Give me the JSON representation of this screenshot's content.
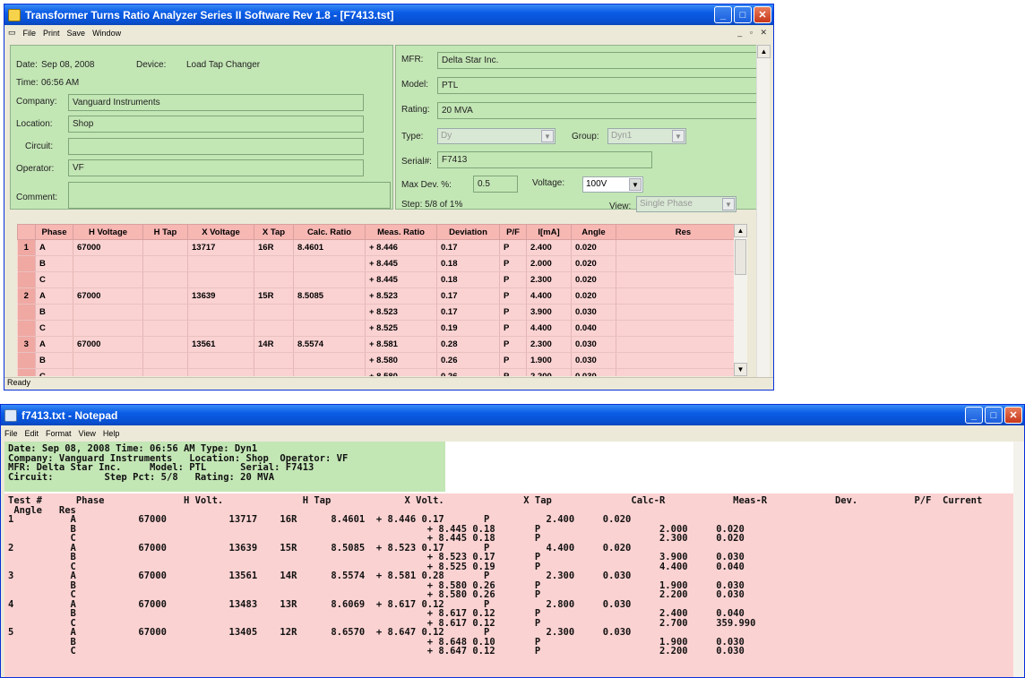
{
  "main_window": {
    "title": "Transformer Turns Ratio Analyzer Series II Software Rev 1.8 - [F7413.tst]",
    "menu": [
      "File",
      "Print",
      "Save",
      "Window"
    ],
    "status": "Ready"
  },
  "form": {
    "date_label": "Date:",
    "date": "Sep 08, 2008",
    "device_label": "Device:",
    "device": "Load Tap Changer",
    "time_label": "Time:",
    "time": "06:56 AM",
    "company_label": "Company:",
    "company": "Vanguard Instruments",
    "location_label": "Location:",
    "location": "Shop",
    "circuit_label": "Circuit:",
    "circuit": "",
    "operator_label": "Operator:",
    "operator": "VF",
    "comment_label": "Comment:",
    "comment": "",
    "mfr_label": "MFR:",
    "mfr": "Delta Star Inc.",
    "model_label": "Model:",
    "model": "PTL",
    "rating_label": "Rating:",
    "rating": "20 MVA",
    "type_label": "Type:",
    "type": "Dy",
    "group_label": "Group:",
    "group": "Dyn1",
    "serial_label": "Serial#:",
    "serial": "F7413",
    "maxdev_label": "Max Dev. %:",
    "maxdev": "0.5",
    "voltage_label": "Voltage:",
    "voltage": "100V",
    "step_label": "Step: 5/8 of 1%",
    "view_label": "View:",
    "view": "Single Phase"
  },
  "grid": {
    "headers": [
      "",
      "Phase",
      "H Voltage",
      "H Tap",
      "X Voltage",
      "X Tap",
      "Calc. Ratio",
      "Meas. Ratio",
      "Deviation",
      "P/F",
      "I[mA]",
      "Angle",
      "Res"
    ],
    "rows": [
      [
        "1",
        "A",
        "67000",
        "",
        "13717",
        "16R",
        "8.4601",
        "+ 8.446",
        "0.17",
        "P",
        "2.400",
        "0.020",
        ""
      ],
      [
        "",
        "B",
        "",
        "",
        "",
        "",
        "",
        "+ 8.445",
        "0.18",
        "P",
        "2.000",
        "0.020",
        ""
      ],
      [
        "",
        "C",
        "",
        "",
        "",
        "",
        "",
        "+ 8.445",
        "0.18",
        "P",
        "2.300",
        "0.020",
        ""
      ],
      [
        "2",
        "A",
        "67000",
        "",
        "13639",
        "15R",
        "8.5085",
        "+ 8.523",
        "0.17",
        "P",
        "4.400",
        "0.020",
        ""
      ],
      [
        "",
        "B",
        "",
        "",
        "",
        "",
        "",
        "+ 8.523",
        "0.17",
        "P",
        "3.900",
        "0.030",
        ""
      ],
      [
        "",
        "C",
        "",
        "",
        "",
        "",
        "",
        "+ 8.525",
        "0.19",
        "P",
        "4.400",
        "0.040",
        ""
      ],
      [
        "3",
        "A",
        "67000",
        "",
        "13561",
        "14R",
        "8.5574",
        "+ 8.581",
        "0.28",
        "P",
        "2.300",
        "0.030",
        ""
      ],
      [
        "",
        "B",
        "",
        "",
        "",
        "",
        "",
        "+ 8.580",
        "0.26",
        "P",
        "1.900",
        "0.030",
        ""
      ],
      [
        "",
        "C",
        "",
        "",
        "",
        "",
        "",
        "+ 8.580",
        "0.26",
        "P",
        "2.200",
        "0.030",
        ""
      ]
    ]
  },
  "notepad": {
    "title": "f7413.txt - Notepad",
    "menu": [
      "File",
      "Edit",
      "Format",
      "View",
      "Help"
    ],
    "header_text": "Date: Sep 08, 2008 Time: 06:56 AM Type: Dyn1\nCompany: Vanguard Instruments   Location: Shop  Operator: VF\nMFR: Delta Star Inc.     Model: PTL      Serial: F7413\nCircuit:         Step Pct: 5/8   Rating: 20 MVA",
    "body_text": "Test #      Phase              H Volt.              H Tap             X Volt.              X Tap              Calc-R            Meas-R            Dev.          P/F  Current\n Angle   Res\n1          A           67000           13717    16R      8.4601  + 8.446 0.17       P          2.400     0.020\n           B                                                              + 8.445 0.18       P                     2.000     0.020\n           C                                                              + 8.445 0.18       P                     2.300     0.020\n2          A           67000           13639    15R      8.5085  + 8.523 0.17       P          4.400     0.020\n           B                                                              + 8.523 0.17       P                     3.900     0.030\n           C                                                              + 8.525 0.19       P                     4.400     0.040\n3          A           67000           13561    14R      8.5574  + 8.581 0.28       P          2.300     0.030\n           B                                                              + 8.580 0.26       P                     1.900     0.030\n           C                                                              + 8.580 0.26       P                     2.200     0.030\n4          A           67000           13483    13R      8.6069  + 8.617 0.12       P          2.800     0.030\n           B                                                              + 8.617 0.12       P                     2.400     0.040\n           C                                                              + 8.617 0.12       P                     2.700     359.990\n5          A           67000           13405    12R      8.6570  + 8.647 0.12       P          2.300     0.030\n           B                                                              + 8.648 0.10       P                     1.900     0.030\n           C                                                              + 8.647 0.12       P                     2.200     0.030"
  },
  "colors": {
    "green_panel": "#c3e6b5",
    "red_grid": "#fbd2d2",
    "titlebar": "#0a5ce6"
  }
}
